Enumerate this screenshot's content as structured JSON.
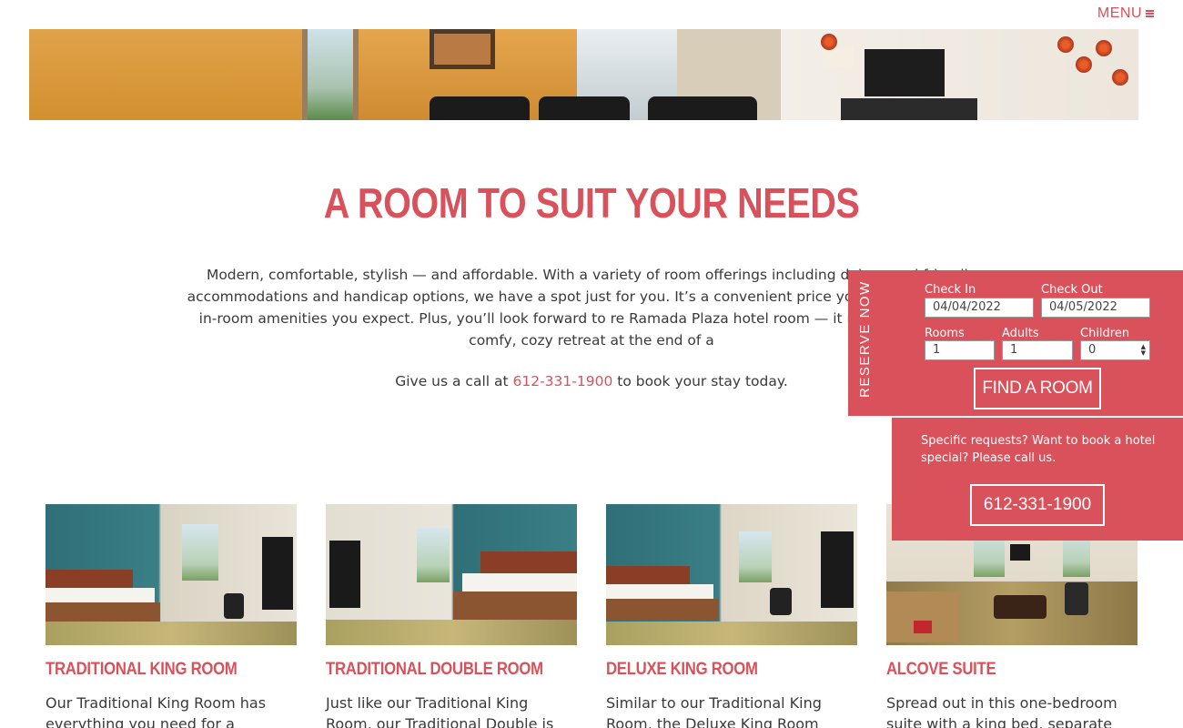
{
  "nav": {
    "menu_label": "MENU"
  },
  "section": {
    "title": "A ROOM TO SUIT YOUR NEEDS",
    "intro": "Modern, comfortable, stylish — and affordable. With a variety of room offerings including deluxe and friendly accommodations and handicap options, we have a spot just for you. It’s a convenient price you’ll love, with all the in-room amenities you expect. Plus, you’ll look forward to re Ramada Plaza hotel room — it really is the perfect comfy, cozy retreat at the end of a",
    "call_prefix": "Give us a call at",
    "phone": "612-331-1900",
    "call_suffix": "to book your stay today."
  },
  "rooms": [
    {
      "title": "TRADITIONAL KING ROOM",
      "desc": "Our Traditional King Room has everything you need for a"
    },
    {
      "title": "TRADITIONAL DOUBLE ROOM",
      "desc": "Just like our Traditional King Room, our Traditional Double is a"
    },
    {
      "title": "DELUXE KING ROOM",
      "desc": "Similar to our Traditional King Room, the Deluxe King Room"
    },
    {
      "title": "ALCOVE SUITE",
      "desc": "Spread out in this one-bedroom suite with a king bed, separate"
    }
  ],
  "reserve": {
    "label": "RESERVE NOW",
    "check_in_label": "Check In",
    "check_in_value": "04/04/2022",
    "check_out_label": "Check Out",
    "check_out_value": "04/05/2022",
    "rooms_label": "Rooms",
    "rooms_value": "1",
    "adults_label": "Adults",
    "adults_value": "1",
    "children_label": "Children",
    "children_value": "0",
    "find_button": "FIND A ROOM"
  },
  "special": {
    "text": "Specific requests? Want to book a hotel special? Please call us.",
    "phone_button": "612-331-1900"
  },
  "colors": {
    "accent": "#d9515a",
    "text": "#3a3a3a"
  }
}
